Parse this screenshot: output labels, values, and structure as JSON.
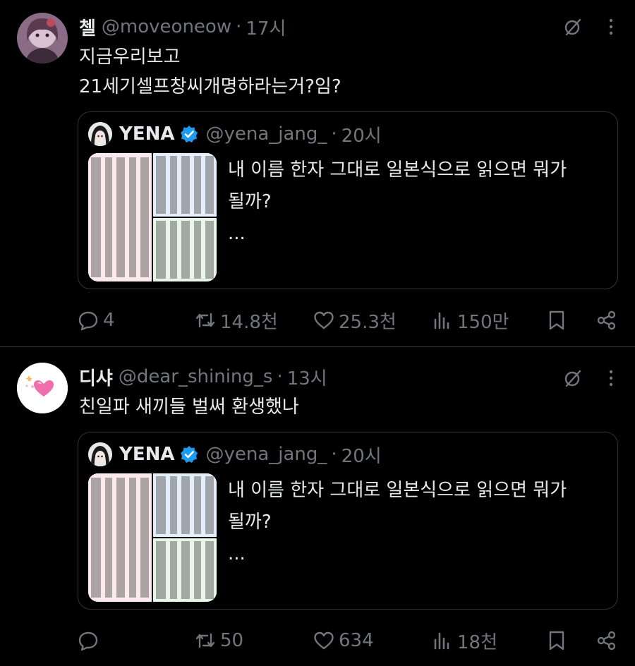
{
  "tweets": [
    {
      "name": "첼",
      "handle": "@moveoneow",
      "time": "17시",
      "text_lines": [
        "지금우리보고",
        "21세기셀프창씨개명하라는거?임?"
      ],
      "quote": {
        "name": "YENA",
        "handle": "@yena_jang_",
        "time": "20시",
        "text_lines": [
          "내 이름 한자 그대로 일본식으로 읽으면 뭐가",
          "될까?",
          "..."
        ]
      },
      "actions": {
        "replies": "4",
        "retweets": "14.8천",
        "likes": "25.3천",
        "views": "150만"
      }
    },
    {
      "name": "디샤",
      "handle": "@dear_shining_s",
      "time": "13시",
      "text_lines": [
        "친일파 새끼들 벌써 환생했나"
      ],
      "quote": {
        "name": "YENA",
        "handle": "@yena_jang_",
        "time": "20시",
        "text_lines": [
          "내 이름 한자 그대로 일본식으로 읽으면 뭐가",
          "될까?",
          "..."
        ]
      },
      "actions": {
        "replies": "",
        "retweets": "50",
        "likes": "634",
        "views": "18천"
      }
    }
  ],
  "separator": "·",
  "icons": [
    "grok-icon",
    "more-icon",
    "verified-badge-icon",
    "reply-icon",
    "retweet-icon",
    "like-icon",
    "views-icon",
    "bookmark-icon",
    "share-icon"
  ],
  "colors": {
    "background": "#000000",
    "text": "#e7e9ea",
    "muted": "#71767b",
    "border": "#2f3336",
    "verified": "#1d9bf0"
  }
}
